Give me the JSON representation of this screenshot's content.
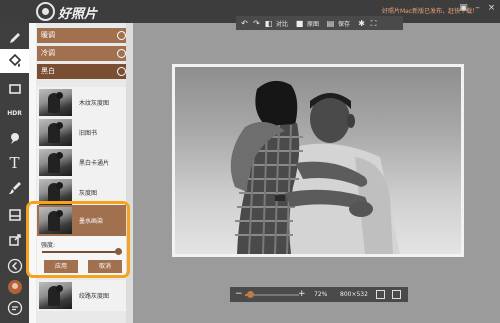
{
  "app": {
    "logo_text": "好照片",
    "notice": "好照片Mac新版已发布，赶快下载！"
  },
  "toolbar_top": {
    "compare_label": "对比",
    "original_label": "原图",
    "save_label": "保存"
  },
  "panel": {
    "categories": [
      {
        "label": "暖调"
      },
      {
        "label": "冷调"
      },
      {
        "label": "黑白"
      }
    ],
    "filters": [
      {
        "label": "木纹灰度图"
      },
      {
        "label": "旧图书"
      },
      {
        "label": "黑白卡通片"
      },
      {
        "label": "灰度图"
      }
    ],
    "selected_filter": {
      "label": "墨水画染",
      "strength_label": "强度:",
      "strength": 0.95,
      "apply_label": "应用",
      "cancel_label": "取消"
    },
    "next_filter": {
      "label": "绞路灰度图"
    }
  },
  "bottom": {
    "zoom": 0.1,
    "zoom_text": "72%",
    "image_size": "800×532"
  },
  "colors": {
    "accent": "#a0704f",
    "accent_dark": "#7a4e33",
    "highlight": "#f4a31f",
    "notice": "#e9a07c"
  }
}
